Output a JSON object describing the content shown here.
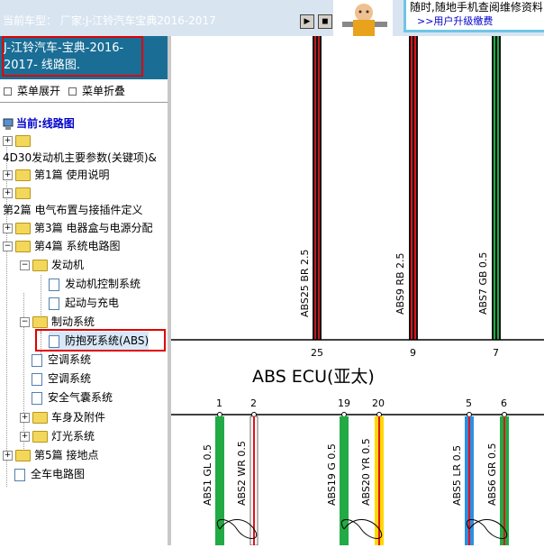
{
  "topbar": {
    "car_type": "当前车型： 厂家:J-江铃汽车宝典2016-2017",
    "banner_line1": "随时,随地手机查阅维修资料",
    "banner_line2": ">>用户升级缴费"
  },
  "sidebar": {
    "title": "J-江铃汽车-宝典-2016-2017- 线路图.",
    "expand_label": "菜单展开",
    "collapse_label": "菜单折叠",
    "current_label": "当前:线路图",
    "tree": [
      {
        "label": ""
      },
      {
        "label": "4D30发动机主要参数(关键项)&"
      },
      {
        "label": "第1篇 使用说明"
      },
      {
        "label": ""
      },
      {
        "label": "第2篇 电气布置与接插件定义"
      },
      {
        "label": "第3篇 电器盒与电源分配"
      },
      {
        "label": "第4篇 系统电路图"
      },
      {
        "label": "发动机"
      },
      {
        "label": "发动机控制系统"
      },
      {
        "label": "起动与充电"
      },
      {
        "label": "制动系统"
      },
      {
        "label": "防抱死系统(ABS)"
      },
      {
        "label": "空调系统"
      },
      {
        "label": "空调系统"
      },
      {
        "label": "安全气囊系统"
      },
      {
        "label": "车身及附件"
      },
      {
        "label": "灯光系统"
      },
      {
        "label": "第5篇 接地点"
      },
      {
        "label": "全车电路图"
      }
    ]
  },
  "diagram": {
    "ecu_label": "ABS  ECU(亚太)",
    "top_wires": [
      {
        "label": "ABS25  BR  2.5",
        "pin": "25",
        "color": "#c0181c",
        "stripe": "#111111"
      },
      {
        "label": "ABS9  RB  2.5",
        "pin": "9",
        "color": "#e0121a",
        "stripe": "#111111"
      },
      {
        "label": "ABS7  GB  0.5",
        "pin": "7",
        "color": "#22aa44",
        "stripe": "#111111"
      }
    ],
    "bottom_wires": [
      {
        "label": "ABS1  GL  0.5",
        "pin": "1",
        "color": "#22aa44",
        "stripe": "#22aa44"
      },
      {
        "label": "ABS2  WR  0.5",
        "pin": "2",
        "color": "#ffffff",
        "stripe": "#e0121a"
      },
      {
        "label": "ABS19  G  0.5",
        "pin": "19",
        "color": "#22aa44",
        "stripe": "#22aa44"
      },
      {
        "label": "ABS20  YR  0.5",
        "pin": "20",
        "color": "#ffd800",
        "stripe": "#e0121a"
      },
      {
        "label": "ABS5  LR  0.5",
        "pin": "5",
        "color": "#2d8ee0",
        "stripe": "#e0121a"
      },
      {
        "label": "ABS6  GR  0.5",
        "pin": "6",
        "color": "#22aa44",
        "stripe": "#e0121a"
      }
    ]
  }
}
